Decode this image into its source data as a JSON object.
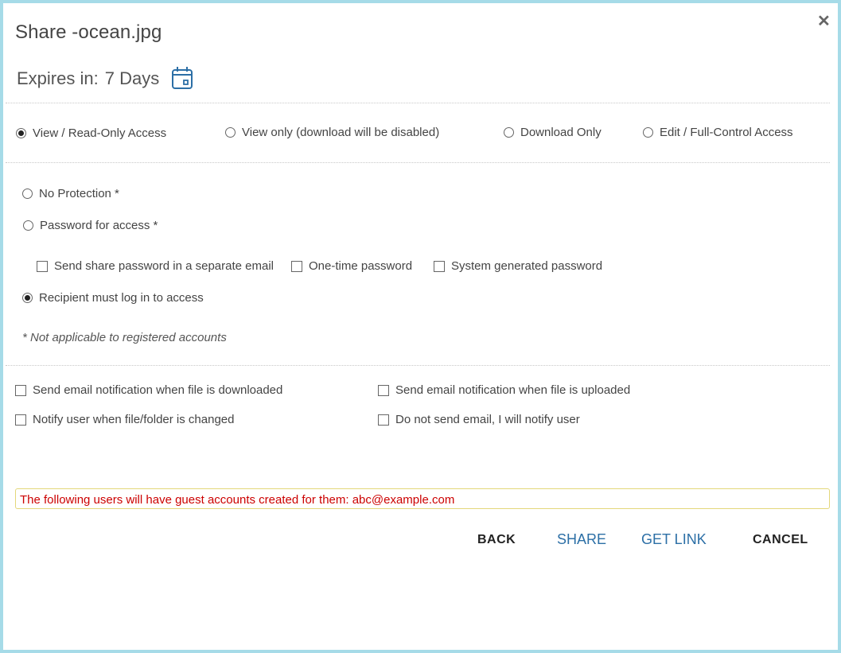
{
  "dialog": {
    "title": "Share -ocean.jpg",
    "expires_label": "Expires in:",
    "expires_value": "7 Days"
  },
  "access_options": [
    {
      "label": "View / Read-Only Access",
      "selected": true
    },
    {
      "label": "View only (download will be disabled)",
      "selected": false
    },
    {
      "label": "Download Only",
      "selected": false
    },
    {
      "label": "Edit / Full-Control Access",
      "selected": false
    }
  ],
  "protection_options": {
    "no_protection": {
      "label": "No Protection *",
      "selected": false
    },
    "password": {
      "label": "Password for access *",
      "selected": false
    },
    "password_suboptions": [
      {
        "label": "Send share password in a separate email",
        "checked": false
      },
      {
        "label": "One-time password",
        "checked": false
      },
      {
        "label": "System generated password",
        "checked": false
      }
    ],
    "login_required": {
      "label": "Recipient must log in to access",
      "selected": true
    }
  },
  "note": "* Not applicable to registered accounts",
  "notifications": [
    {
      "label": "Send email notification when file is downloaded",
      "checked": false
    },
    {
      "label": "Send email notification when file is uploaded",
      "checked": false
    },
    {
      "label": "Notify user when file/folder is changed",
      "checked": false
    },
    {
      "label": "Do not send email, I will notify user",
      "checked": false
    }
  ],
  "guest_message": "The following users will have guest accounts created for them: abc@example.com",
  "buttons": {
    "back": "BACK",
    "share": "SHARE",
    "get_link": "GET LINK",
    "cancel": "CANCEL"
  },
  "icons": {
    "close": "close-icon",
    "calendar": "calendar-icon"
  },
  "colors": {
    "frame_border": "#a6dbe8",
    "link_blue": "#2c6fa6",
    "warning_red": "#cc0000",
    "warning_border": "#e3d77a"
  }
}
